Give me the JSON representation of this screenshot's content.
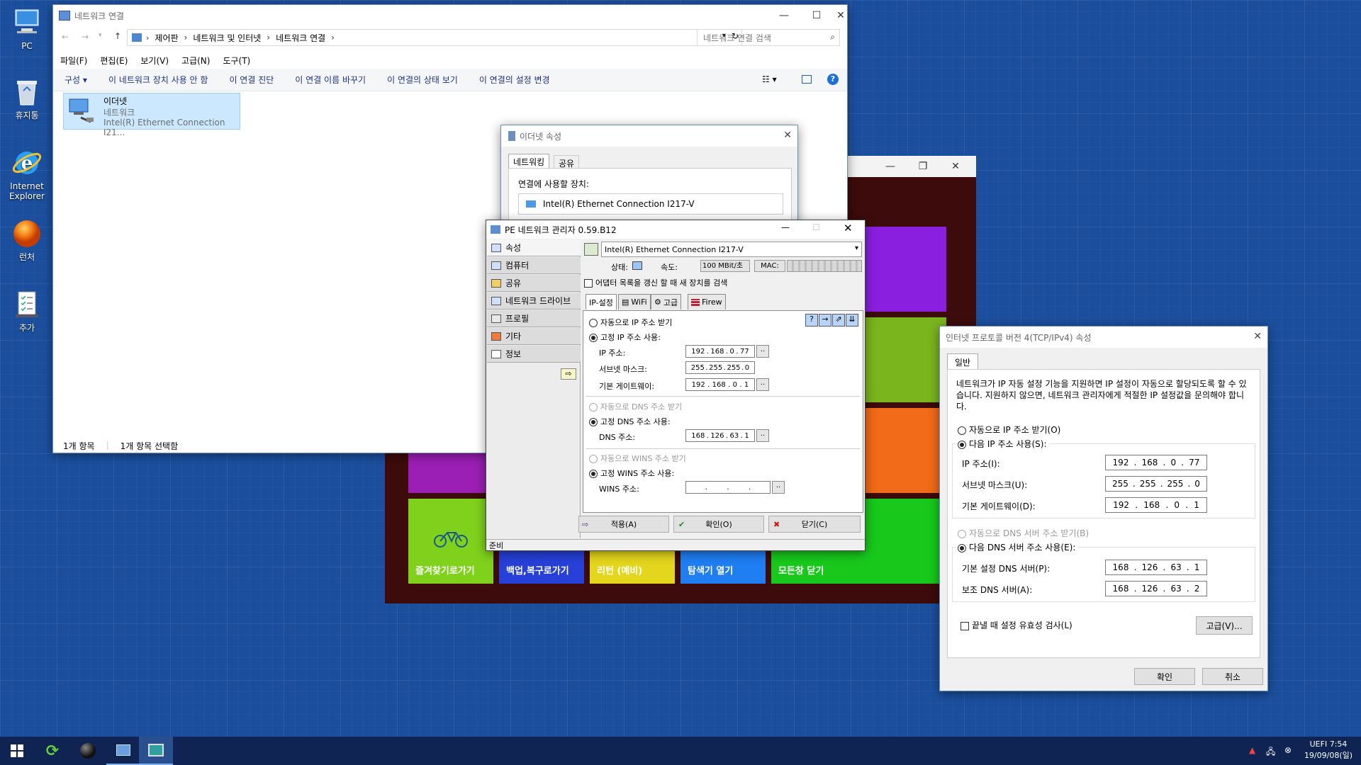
{
  "desktop": {
    "icons": [
      {
        "label": "PC"
      },
      {
        "label": "휴지통"
      },
      {
        "label": "Internet Explorer"
      },
      {
        "label": "런처"
      },
      {
        "label": "추가"
      }
    ]
  },
  "netconn": {
    "title": "네트워크 연결",
    "breadcrumb": [
      "제어판",
      "네트워크 및 인터넷",
      "네트워크 연결"
    ],
    "search_placeholder": "네트워크 연결 검색",
    "menu": [
      "파일(F)",
      "편집(E)",
      "보기(V)",
      "고급(N)",
      "도구(T)"
    ],
    "toolbar": {
      "organize": "구성",
      "items": [
        "이 네트워크 장치 사용 안 함",
        "이 연결 진단",
        "이 연결 이름 바꾸기",
        "이 연결의 상태 보기",
        "이 연결의 설정 변경"
      ]
    },
    "item": {
      "name": "이더넷",
      "type": "네트워크",
      "device": "Intel(R) Ethernet Connection I21..."
    },
    "status": {
      "count": "1개 항목",
      "selected": "1개 항목 선택함"
    }
  },
  "eth_props": {
    "title": "이더넷 속성",
    "tabs": [
      "네트워킹",
      "공유"
    ],
    "connect_using": "연결에 사용할 장치:",
    "adapter": "Intel(R) Ethernet Connection I217-V"
  },
  "pe": {
    "title": "PE 네트워크 관리자 0.59.B12",
    "sidebar": [
      "속성",
      "컴퓨터",
      "공유",
      "네트워크 드라이브",
      "프로필",
      "기타",
      "정보"
    ],
    "adapter": "Intel(R) Ethernet Connection I217-V",
    "status_label": "상태:",
    "speed_label": "속도:",
    "speed": "100 MBit/초",
    "mac_label": "MAC:",
    "refresh_check": "어댑터 목록을 갱신 할 때 새 장치를 검색",
    "tabs": [
      "IP-설정",
      "WiFi",
      "고급",
      "Firew"
    ],
    "ip": {
      "auto": "자동으로 IP 주소 받기",
      "static": "고정 IP 주소 사용:",
      "ip_label": "IP 주소:",
      "ip": [
        "192",
        "168",
        "0",
        "77"
      ],
      "mask_label": "서브넷 마스크:",
      "mask": [
        "255",
        "255",
        "255",
        "0"
      ],
      "gw_label": "기본 게이트웨이:",
      "gw": [
        "192",
        "168",
        "0",
        "1"
      ]
    },
    "dns": {
      "auto": "자동으로 DNS 주소 받기",
      "static": "고정 DNS 주소 사용:",
      "label": "DNS 주소:",
      "value": [
        "168",
        "126",
        "63",
        "1"
      ]
    },
    "wins": {
      "auto": "자동으로 WINS 주소 받기",
      "static": "고정 WINS 주소 사용:",
      "label": "WINS 주소:",
      "value": [
        "",
        "",
        "",
        ""
      ]
    },
    "buttons": {
      "apply": "적용(A)",
      "ok": "확인(O)",
      "close": "닫기(C)"
    },
    "statusbar": "준비"
  },
  "launcher": {
    "tiles": [
      "즐겨찾기로가기",
      "백업,복구로가기",
      "리턴 (예비)",
      "탐색기 열기",
      "모든창 닫기"
    ]
  },
  "ipv4": {
    "title": "인터넷 프로토콜 버전 4(TCP/IPv4) 속성",
    "tab": "일반",
    "desc": "네트워크가 IP 자동 설정 기능을 지원하면 IP 설정이 자동으로 할당되도록 할 수 있습니다. 지원하지 않으면, 네트워크 관리자에게 적절한 IP 설정값을 문의해야 합니다.",
    "auto_ip": "자동으로 IP 주소 받기(O)",
    "static_ip": "다음 IP 주소 사용(S):",
    "ip_label": "IP 주소(I):",
    "ip": [
      "192",
      "168",
      "0",
      "77"
    ],
    "mask_label": "서브넷 마스크(U):",
    "mask": [
      "255",
      "255",
      "255",
      "0"
    ],
    "gw_label": "기본 게이트웨이(D):",
    "gw": [
      "192",
      "168",
      "0",
      "1"
    ],
    "auto_dns": "자동으로 DNS 서버 주소 받기(B)",
    "static_dns": "다음 DNS 서버 주소 사용(E):",
    "dns1_label": "기본 설정 DNS 서버(P):",
    "dns1": [
      "168",
      "126",
      "63",
      "1"
    ],
    "dns2_label": "보조 DNS 서버(A):",
    "dns2": [
      "168",
      "126",
      "63",
      "2"
    ],
    "validate": "끝낼 때 설정 유효성 검사(L)",
    "advanced": "고급(V)...",
    "ok": "확인",
    "cancel": "취소"
  },
  "taskbar": {
    "tray": [
      "UEFI",
      "7:54",
      "19/09/08(일)"
    ]
  }
}
